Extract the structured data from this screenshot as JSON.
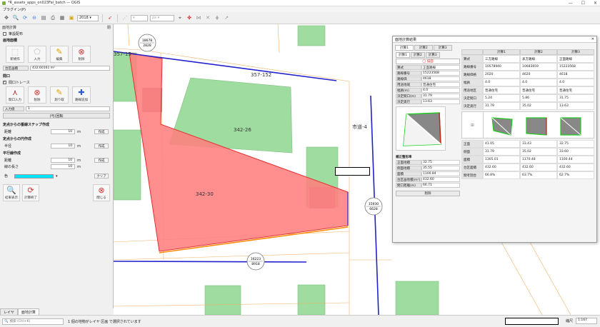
{
  "window": {
    "title": "*R_assets_apps_on023Fal_batch — QGIS",
    "controls": [
      "—",
      "☐",
      "✕"
    ]
  },
  "menu": {
    "label": "プラグイン(P)"
  },
  "toolbar": {
    "year_value": "2018"
  },
  "left_panel": {
    "title": "面地計算",
    "close_label": "閉",
    "reference_label": "筆設配布",
    "section_area": "画地面積",
    "btn_new": "新規作",
    "btn_input": "入力",
    "btn_edit": "編集",
    "btn_delete": "削除",
    "area_field": "台区画積",
    "area_value": "432.60161 m²",
    "section_frontage": "間口",
    "trace_label": "間口トレース",
    "btn_frontage_input": "間口入力",
    "btn_frontage_delete": "削除",
    "btn_measure": "測り取",
    "btn_add_road": "路線追加",
    "input_label": "入力値",
    "input_value": "1",
    "btn_batch": "(与)回転",
    "section_perp": "定点からの垂線ステップ作成",
    "dist_label1": "距離",
    "dist_value1": "10",
    "unit_m": "m",
    "btn_create": "作成",
    "section_circle": "定点からの円作成",
    "radius_label": "半径",
    "radius_value": "10",
    "section_parallel": "平行線作成",
    "dist_label2": "距離",
    "dist_value2": "10",
    "length_label": "線の長さ",
    "length_value": "10",
    "color_label": "色",
    "btn_clear": "クリア",
    "btn_result": "結果表示",
    "btn_close_calc": "計算終了",
    "btn_close": "閉じる",
    "tabs": [
      "レイヤ",
      "面地計算"
    ]
  },
  "map": {
    "parcels": [
      "342-26",
      "342-30",
      "357-152",
      "357-15"
    ],
    "road": "市道-4",
    "markers": [
      {
        "top": "18678",
        "bottom": "2828"
      },
      {
        "top": "15930",
        "bottom": "6628"
      },
      {
        "top": "16223",
        "bottom": "8918"
      }
    ]
  },
  "popup": {
    "title": "面地計算結果",
    "tabs": [
      "計算1",
      "計算2",
      "計算3"
    ],
    "sub_tabs": [
      "計算1",
      "計算2",
      "計算3"
    ],
    "clear_button": "◯ 描面",
    "form": [
      {
        "label": "算式",
        "value": "正面路線"
      },
      {
        "label": "路線番号",
        "value": "15223568"
      },
      {
        "label": "路線価",
        "value": "4618"
      },
      {
        "label": "用途地域",
        "value": "普通住宅"
      },
      {
        "label": "幅員(m)",
        "value": "4.0"
      },
      {
        "label": "決定間口(m)",
        "value": "31.79"
      },
      {
        "label": "決定奥行",
        "value": "13.63"
      }
    ],
    "summary": [
      {
        "label": "正面地積",
        "value": "32.75"
      },
      {
        "label": "側面地積",
        "value": "35.55"
      },
      {
        "label": "面積",
        "value": "1100.84"
      },
      {
        "label": "台区画地積(m²)",
        "value": "432.60"
      },
      {
        "label": "間口距離(m)",
        "value": "66.71"
      }
    ],
    "delete_button": "削除",
    "table_headers": [
      "",
      "計算1",
      "計算2",
      "計算3"
    ],
    "table_rows": [
      [
        "算式",
        "三方路線",
        "表方路線",
        "正面路線"
      ],
      [
        "路線番号",
        "10578940",
        "10683659",
        "15223568"
      ],
      [
        "路線価格",
        "2020",
        "4620",
        "4618"
      ],
      [
        "幅員",
        "4.0",
        "4.0",
        "4.0"
      ],
      [
        "用途地区",
        "普通住宅",
        "普通住宅",
        "普通住宅"
      ],
      [
        "決定間口",
        "5.24",
        "5.86",
        "31.75"
      ],
      [
        "決定奥行",
        "31.79",
        "35.02",
        "13.63"
      ]
    ],
    "table_rows2": [
      [
        "正面",
        "41.05",
        "33.43",
        "32.75"
      ],
      [
        "側面",
        "31.79",
        "35.02",
        "33.60"
      ],
      [
        "面積",
        "1305.01",
        "1170.48",
        "1100.44"
      ],
      [
        "台区面積",
        "432.60",
        "432.60",
        "432.60"
      ],
      [
        "間考割合",
        "66.8%",
        "63.7%",
        "62.7%"
      ]
    ]
  },
  "status": {
    "search_placeholder": "検索 (Ctrl+K)",
    "message": "1 個の地物がレイヤ 区画 で選択されています",
    "scale_label": "縮尺",
    "scale_value": "1:167"
  }
}
